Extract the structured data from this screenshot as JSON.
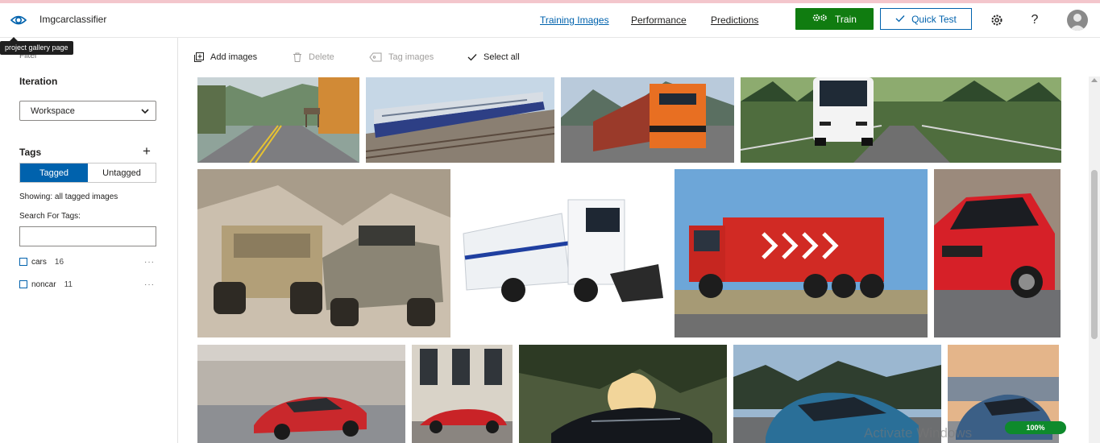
{
  "app": {
    "name": "Imgcarclassifier",
    "tooltip": "project gallery page",
    "filter_label": "Filter"
  },
  "nav": {
    "tabs": [
      "Training Images",
      "Performance",
      "Predictions"
    ],
    "active": "Training Images"
  },
  "actions": {
    "train_label": "Train",
    "quick_test_label": "Quick Test",
    "help_label": "?"
  },
  "colors": {
    "accent": "#0062ad",
    "train": "#107c10",
    "zoom_badge": "#0e8a2c"
  },
  "sidebar": {
    "iteration_heading": "Iteration",
    "iteration_value": "Workspace",
    "tags_heading": "Tags",
    "toggle": [
      "Tagged",
      "Untagged"
    ],
    "toggle_selected": "Tagged",
    "showing_text": "Showing: all tagged images",
    "search_label": "Search For Tags:",
    "search_value": "",
    "tags": [
      {
        "name": "cars",
        "count": "16"
      },
      {
        "name": "noncar",
        "count": "11"
      }
    ],
    "more_label": "···"
  },
  "toolbar": {
    "add": "Add images",
    "delete": "Delete",
    "tag": "Tag images",
    "select_all": "Select all"
  },
  "gallery": {
    "images": [
      "road-with-deer",
      "passenger-train",
      "freight-locomotive",
      "white-bus",
      "military-vehicles",
      "riot-control-truck",
      "red-fire-truck",
      "red-hatchback",
      "red-sports-car-moving",
      "red-sports-car-parked",
      "black-muscle-car",
      "blue-hatchback",
      "blue-sedan"
    ]
  },
  "status": {
    "zoom": "100%",
    "watermark": "Activate Windows"
  }
}
